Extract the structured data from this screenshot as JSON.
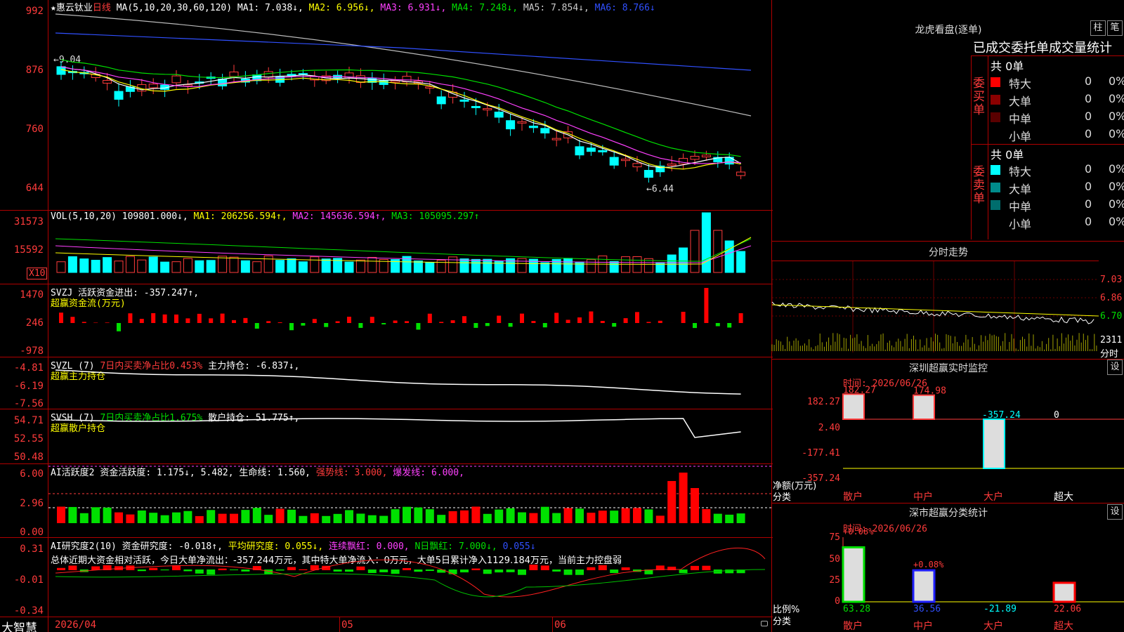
{
  "header": {
    "star": "★",
    "stock_name": "惠云钛业",
    "period": "日线",
    "ma_label": "MA(5,10,20,30,60,120)",
    "ma1": "MA1: 7.038↓,",
    "ma2": "MA2: 6.956↓,",
    "ma3": "MA3: 6.931↓,",
    "ma4": "MA4: 7.248↓,",
    "ma5": "MA5: 7.854↓,",
    "ma6": "MA6: 8.766↓",
    "high_marker": "9.04",
    "low_marker": "6.44"
  },
  "price_axis": [
    "992",
    "876",
    "760",
    "644"
  ],
  "vol": {
    "title": "VOL(5,10,20)",
    "value": "109801.000↓,",
    "ma1": "MA1: 206256.594↑,",
    "ma2": "MA2: 145636.594↑,",
    "ma3": "MA3: 105095.297↑",
    "axis": [
      "31573",
      "15592"
    ],
    "unit": "X10"
  },
  "svzj": {
    "line1": "SVZJ  活跃资金进出: -357.247↑,",
    "line2": "超赢资金流(万元)",
    "axis": [
      "1470",
      "246",
      "-978"
    ]
  },
  "svzl": {
    "title": "SVZL (7)",
    "note": "7日内买卖净占比0.453%",
    "value": "主力持仓: -6.837↓,",
    "line2": "超赢主力持仓",
    "axis": [
      "-4.81",
      "-6.19",
      "-7.56"
    ]
  },
  "svsh": {
    "title": "SVSH (7)",
    "note": "7日内买卖净占比1.675%",
    "value": "散户持仓: 51.775↑,",
    "line2": "超赢散户持仓",
    "axis": [
      "54.71",
      "52.55",
      "50.48"
    ]
  },
  "ai1": {
    "title": "AI活跃度2",
    "v1": "资金活跃度: 1.175↓,",
    "v2": "5.482,",
    "v3": "生命线: 1.560,",
    "v4": "强势线: 3.000,",
    "v5": "爆发线: 6.000,",
    "axis": [
      "6.00",
      "2.96",
      "0.00"
    ]
  },
  "ai2": {
    "title": "AI研究度2(10)",
    "v1": "资金研究度: -0.018↑,",
    "v2": "平均研究度: 0.055↓,",
    "v3": "连续飘红: 0.000,",
    "v4": "N日飘红: 7.000↓,",
    "v5": "0.055↓",
    "summary": "总体近期大资金相对活跃，今日大单净流出：-357.244万元，其中特大单净流入：0万元，大单5日累计净入1129.184万元，当前主力控盘弱",
    "axis": [
      "0.31",
      "-0.01",
      "-0.34"
    ]
  },
  "footer": {
    "brand": "大智慧",
    "date_start": "2026/04",
    "month_05": "05",
    "month_06": "06"
  },
  "dragon": {
    "title": "龙虎看盘(逐单)",
    "btn_zhu": "柱",
    "btn_bi": "笔",
    "header": "已成交委托单成交量统计",
    "buy_side": "委买单",
    "sell_side": "委卖单",
    "buy_total": "共 0单",
    "sell_total": "共 0单",
    "buy_rows": [
      {
        "name": "特大",
        "v": "0",
        "p": "0%",
        "color": "#ff0000"
      },
      {
        "name": "大单",
        "v": "0",
        "p": "0%",
        "color": "#8b0000"
      },
      {
        "name": "中单",
        "v": "0",
        "p": "0%",
        "color": "#5a0000"
      },
      {
        "name": "小单",
        "v": "0",
        "p": "0%",
        "color": "#000000"
      }
    ],
    "sell_rows": [
      {
        "name": "特大",
        "v": "0",
        "p": "0%",
        "color": "#00ffff"
      },
      {
        "name": "大单",
        "v": "0",
        "p": "0%",
        "color": "#008b8b"
      },
      {
        "name": "中单",
        "v": "0",
        "p": "0%",
        "color": "#006d6d"
      },
      {
        "name": "小单",
        "v": "0",
        "p": "0%",
        "color": "#000000"
      }
    ]
  },
  "intraday": {
    "title": "分时走势",
    "axis": [
      "7.03",
      "6.86",
      "6.70",
      "2311"
    ],
    "label_fenshi": "分时"
  },
  "monitor": {
    "title": "深圳超赢实时监控",
    "btn": "设",
    "time": "时间: 2026/06/26",
    "axis": [
      "182.27",
      "2.40",
      "-177.41",
      "-357.24"
    ],
    "net_label": "净额(万元)",
    "cat_label": "分类",
    "bar_values": [
      "182.27",
      "174.98",
      "-357.24",
      "0"
    ],
    "categories": [
      "散户",
      "中户",
      "大户",
      "超大"
    ]
  },
  "stats": {
    "title": "深市超赢分类统计",
    "btn": "设",
    "time": "时间: 2026/06/26",
    "axis": [
      "75",
      "50",
      "25",
      "0"
    ],
    "ratio_label": "比例%",
    "cat_label": "分类",
    "top_labels": [
      "+0.08%",
      "+0.08%"
    ],
    "bottom_values": [
      "63.28",
      "36.56",
      "-21.89",
      "22.06"
    ],
    "categories": [
      "散户",
      "中户",
      "大户",
      "超大"
    ]
  },
  "chart_data": [
    {
      "type": "candlestick",
      "title": "",
      "series": [
        {
          "name": "MA1",
          "values": [
            7.038
          ]
        },
        {
          "name": "MA2",
          "values": [
            6.956
          ]
        },
        {
          "name": "MA3",
          "values": [
            6.931
          ]
        },
        {
          "name": "MA4",
          "values": [
            7.248
          ]
        },
        {
          "name": "MA5",
          "values": [
            7.854
          ]
        },
        {
          "name": "MA6",
          "values": [
            8.766
          ]
        }
      ],
      "ylim": [
        6.44,
        9.92
      ]
    },
    {
      "type": "bar",
      "title": "",
      "categories": [
        "散户",
        "中户",
        "大户",
        "超大"
      ],
      "values": [
        182.27,
        174.98,
        -357.24,
        0
      ],
      "ylim": [
        -357.24,
        182.27
      ]
    },
    {
      "type": "bar",
      "title": "",
      "categories": [
        "散户",
        "中户",
        "大户",
        "超大"
      ],
      "values": [
        63.28,
        36.56,
        -21.89,
        22.06
      ],
      "ylim": [
        0,
        75
      ]
    }
  ]
}
